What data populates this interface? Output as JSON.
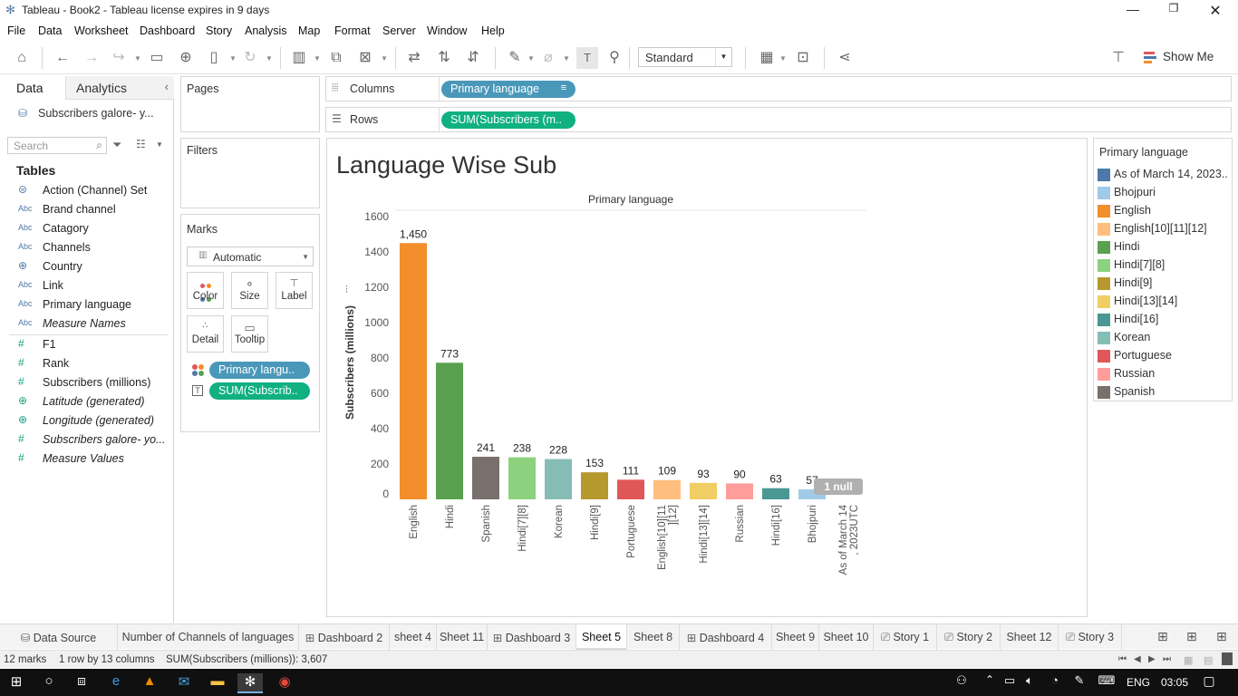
{
  "window": {
    "title": "Tableau - Book2 - Tableau license expires in 9 days"
  },
  "menu": [
    "File",
    "Data",
    "Worksheet",
    "Dashboard",
    "Story",
    "Analysis",
    "Map",
    "Format",
    "Server",
    "Window",
    "Help"
  ],
  "toolbar": {
    "fit_select": "Standard",
    "show_me": "Show Me"
  },
  "data_pane": {
    "tab_data": "Data",
    "tab_analytics": "Analytics",
    "datasource": "Subscribers galore- y...",
    "search_placeholder": "Search",
    "tables_header": "Tables",
    "dimensions": [
      {
        "type": "set",
        "name": "Action (Channel) Set",
        "italic": false
      },
      {
        "type": "Abc",
        "name": "Brand channel",
        "italic": false
      },
      {
        "type": "Abc",
        "name": "Catagory",
        "italic": false
      },
      {
        "type": "Abc",
        "name": "Channels",
        "italic": false
      },
      {
        "type": "geo",
        "name": "Country",
        "italic": false
      },
      {
        "type": "Abc",
        "name": "Link",
        "italic": false
      },
      {
        "type": "Abc",
        "name": "Primary language",
        "italic": false
      },
      {
        "type": "Abc",
        "name": "Measure Names",
        "italic": true
      }
    ],
    "measures": [
      {
        "type": "#",
        "name": "F1",
        "italic": false
      },
      {
        "type": "#",
        "name": "Rank",
        "italic": false
      },
      {
        "type": "#",
        "name": "Subscribers (millions)",
        "italic": false
      },
      {
        "type": "geo",
        "name": "Latitude (generated)",
        "italic": true
      },
      {
        "type": "geo",
        "name": "Longitude (generated)",
        "italic": true
      },
      {
        "type": "#",
        "name": "Subscribers galore- yo...",
        "italic": true
      },
      {
        "type": "#",
        "name": "Measure Values",
        "italic": true
      }
    ]
  },
  "cards": {
    "pages": "Pages",
    "filters": "Filters",
    "marks": "Marks",
    "mark_type": "Automatic",
    "mark_buttons": [
      "Color",
      "Size",
      "Label",
      "Detail",
      "Tooltip"
    ],
    "mark_pills": [
      "Primary langu..",
      "SUM(Subscrib.."
    ]
  },
  "shelves": {
    "columns_label": "Columns",
    "rows_label": "Rows",
    "columns_pill": "Primary language",
    "rows_pill": "SUM(Subscribers (m.."
  },
  "viz": {
    "title": "Language Wise Sub",
    "null_badge": "1 null"
  },
  "chart_data": {
    "type": "bar",
    "title": "Language Wise Sub",
    "xlabel": "Primary language",
    "ylabel": "Subscribers (millions)",
    "ylim": [
      0,
      1600
    ],
    "yticks": [
      0,
      200,
      400,
      600,
      800,
      1000,
      1200,
      1400,
      1600
    ],
    "categories": [
      "English",
      "Hindi",
      "Spanish",
      "Hindi[7][8]",
      "Korean",
      "Hindi[9]",
      "Portuguese",
      "English[10][11][12]",
      "Hindi[13][14]",
      "Russian",
      "Hindi[16]",
      "Bhojpuri",
      "As of March 14, 2023UTC"
    ],
    "values": [
      1450,
      773,
      241,
      238,
      228,
      153,
      111,
      109,
      93,
      90,
      63,
      57,
      null
    ],
    "value_labels": [
      "1,450",
      "773",
      "241",
      "238",
      "228",
      "153",
      "111",
      "109",
      "93",
      "90",
      "63",
      "57",
      ""
    ],
    "colors": [
      "#f28e2b",
      "#59a14f",
      "#79706e",
      "#8cd17d",
      "#86bcb6",
      "#b6992d",
      "#e15759",
      "#ffbe7d",
      "#f1ce63",
      "#ff9d9a",
      "#499894",
      "#a0cbe8",
      "#4e79a7"
    ],
    "grid": false
  },
  "legend": {
    "title": "Primary language",
    "items": [
      {
        "label": "As of March 14, 2023..",
        "color": "#4e79a7"
      },
      {
        "label": "Bhojpuri",
        "color": "#a0cbe8"
      },
      {
        "label": "English",
        "color": "#f28e2b"
      },
      {
        "label": "English[10][11][12]",
        "color": "#ffbe7d"
      },
      {
        "label": "Hindi",
        "color": "#59a14f"
      },
      {
        "label": "Hindi[7][8]",
        "color": "#8cd17d"
      },
      {
        "label": "Hindi[9]",
        "color": "#b6992d"
      },
      {
        "label": "Hindi[13][14]",
        "color": "#f1ce63"
      },
      {
        "label": "Hindi[16]",
        "color": "#499894"
      },
      {
        "label": "Korean",
        "color": "#86bcb6"
      },
      {
        "label": "Portuguese",
        "color": "#e15759"
      },
      {
        "label": "Russian",
        "color": "#ff9d9a"
      },
      {
        "label": "Spanish",
        "color": "#79706e"
      }
    ]
  },
  "sheet_tabs": [
    {
      "label": "Data Source",
      "kind": "datasource"
    },
    {
      "label": "Number of Channels of languages",
      "kind": "sheet"
    },
    {
      "label": "Dashboard 2",
      "kind": "dashboard"
    },
    {
      "label": "sheet 4",
      "kind": "sheet"
    },
    {
      "label": "Sheet 11",
      "kind": "sheet"
    },
    {
      "label": "Dashboard 3",
      "kind": "dashboard"
    },
    {
      "label": "Sheet 5",
      "kind": "sheet",
      "active": true
    },
    {
      "label": "Sheet 8",
      "kind": "sheet"
    },
    {
      "label": "Dashboard 4",
      "kind": "dashboard"
    },
    {
      "label": "Sheet 9",
      "kind": "sheet"
    },
    {
      "label": "Sheet 10",
      "kind": "sheet"
    },
    {
      "label": "Story 1",
      "kind": "story"
    },
    {
      "label": "Story 2",
      "kind": "story"
    },
    {
      "label": "Sheet 12",
      "kind": "sheet"
    },
    {
      "label": "Story 3",
      "kind": "story"
    }
  ],
  "status": {
    "marks": "12 marks",
    "dims": "1 row by 13 columns",
    "sum": "SUM(Subscribers (millions)): 3,607"
  },
  "taskbar": {
    "language": "ENG",
    "time": "03:05"
  }
}
